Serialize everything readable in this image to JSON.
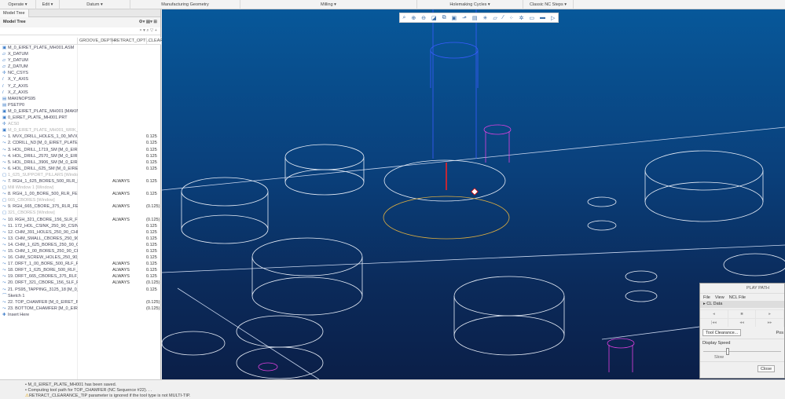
{
  "menubar": [
    "Operate ▾",
    "Edit ▾",
    "Datum ▾",
    "Manufacturing Geometry",
    "Milling ▾",
    "Holemaking Cycles ▾",
    "Classic NC Steps ▾"
  ],
  "tree": {
    "tab": "Model Tree",
    "title": "Model Tree",
    "columns": [
      "GROOVE_DEPTH",
      "RETRACT_OPTI...",
      "CLEAR"
    ],
    "rows": [
      {
        "n": "M_0_EIRET_PLATE_MH001.ASM",
        "i": "▣"
      },
      {
        "n": "X_DATUM",
        "i": "▱"
      },
      {
        "n": "Y_DATUM",
        "i": "▱"
      },
      {
        "n": "Z_DATUM",
        "i": "▱"
      },
      {
        "n": "NC_CSYS",
        "i": "✢"
      },
      {
        "n": "X_Y_AXIS",
        "i": "/"
      },
      {
        "n": "Y_Z_AXIS",
        "i": "/"
      },
      {
        "n": "X_Z_AXIS",
        "i": "/"
      },
      {
        "n": "MAKINOPS95",
        "i": "▤"
      },
      {
        "n": "PSETP0",
        "i": "▤"
      },
      {
        "n": "M_0_EIRET_PLATE_MH001 [MAKINOPS95",
        "i": "▣"
      },
      {
        "n": "0_EIRET_PLATE_MH001.PRT",
        "i": "▣"
      },
      {
        "n": "ACS0",
        "i": "✢",
        "g": 1
      },
      {
        "n": "M_0_EIRET_PLATE_MH001_WRK_01.PRT",
        "i": "▣",
        "g": 1
      },
      {
        "n": "1. MVX_DRILL_HOLES_1_00_MVX_DRILL [",
        "i": "⤳",
        "c": "0.125"
      },
      {
        "n": "2. CDRILL_N3 [M_0_EIRET_PLATE_MH001",
        "i": "⤳",
        "c": "0.125"
      },
      {
        "n": "3. HOL_DRILL_1719_SM [M_0_EIRET_PLA",
        "i": "⤳",
        "c": "0.125"
      },
      {
        "n": "4. HOL_DRILL_2570_SM [M_0_EIRET_PLA",
        "i": "⤳",
        "c": "0.125"
      },
      {
        "n": "5. HOL_DRILL_3906_SM [M_0_EIRET_PLA",
        "i": "⤳",
        "c": "0.125"
      },
      {
        "n": "6. HOL_DRILL_625_SM [M_0_EIRET_PLATE",
        "i": "⤳",
        "c": "0.125"
      },
      {
        "n": "1_625_SUPPORT_PILLARS [Window]",
        "i": "▢",
        "g": 1
      },
      {
        "n": "7. RGH_1_625_BORES_500_RLR_FEM [M_",
        "i": "⤳",
        "r": "ALWAYS",
        "c": "0.125"
      },
      {
        "n": "Mill Window 1 [Window]",
        "i": "▢",
        "g": 1
      },
      {
        "n": "8. RGH_1_00_BORE_500_RLR_FEM [M_0_",
        "i": "⤳",
        "r": "ALWAYS",
        "c": "0.125"
      },
      {
        "n": "665_CBORES [Window]",
        "i": "▢",
        "g": 1
      },
      {
        "n": "9. RGH_665_CBORE_375_RLR_FEM [M_0_",
        "i": "⤳",
        "r": "ALWAYS",
        "c": "(0.125)"
      },
      {
        "n": "321_CBORES [Window]",
        "i": "▢",
        "g": 1
      },
      {
        "n": "10. RGH_321_CBORE_156_SLR_FEM [M_0",
        "i": "⤳",
        "r": "ALWAYS",
        "c": "(0.125)"
      },
      {
        "n": "11. 172_HOL_CSINK_250_90_CSINK [M_0_",
        "i": "⤳",
        "c": "0.125"
      },
      {
        "n": "12. CHM_391_HOLES_250_90_CHM [M_0",
        "i": "⤳",
        "c": "0.125"
      },
      {
        "n": "13. CHM_SMALL_CBORES_250_90_CHM",
        "i": "⤳",
        "c": "0.125"
      },
      {
        "n": "14. CHM_1_625_BORES_250_90_CHM [M",
        "i": "⤳",
        "c": "0.125"
      },
      {
        "n": "15. CHM_1_00_BORES_250_90_CHM [M_",
        "i": "⤳",
        "c": "0.125"
      },
      {
        "n": "16. CHM_SCREW_HOLES_250_90_CHM [I",
        "i": "⤳",
        "c": "0.125"
      },
      {
        "n": "17. DRFT_1_00_BORE_500_RLF_FEM [M_0",
        "i": "⤳",
        "r": "ALWAYS",
        "c": "0.125"
      },
      {
        "n": "18. DRFT_1_625_BORE_500_RLF_FEM [M",
        "i": "⤳",
        "r": "ALWAYS",
        "c": "0.125"
      },
      {
        "n": "19. DRFT_665_CBORES_375_RLF_FEM [M",
        "i": "⤳",
        "r": "ALWAYS",
        "c": "0.125"
      },
      {
        "n": "20. DRFT_321_CBORE_156_SLF_FEM [M_0",
        "i": "⤳",
        "r": "ALWAYS",
        "c": "(0.125)"
      },
      {
        "n": "21. PS95_TAPPING_3125_18 [M_0_EIRET_",
        "i": "⤳",
        "c": "0.125"
      },
      {
        "n": "Sketch 1",
        "i": "⌒"
      },
      {
        "n": "22. TOP_CHAMFER [M_0_EIRET_PLATE_M",
        "i": "⤳",
        "c": "(0.125)"
      },
      {
        "n": "23. BOTTOM_CHAMFER [M_0_EIRET_PLA",
        "i": "⤳",
        "c": "(0.125)"
      },
      {
        "n": "Insert Here",
        "i": "✚"
      }
    ]
  },
  "status": [
    "M_0_EIRET_PLATE_MH001 has been saved.",
    "Computing tool path for TOP_CHAMFER (NC Sequence #22). . .",
    "RETRACT_CLEARANCE_TIP parameter is ignored if the tool type is not MULTI-TIP."
  ],
  "playpath": {
    "title": "PLAY PATH",
    "menu": [
      "File",
      "View",
      "NCL File"
    ],
    "cl_data": "CL Data",
    "tool_clearance": "Tool Clearance...",
    "pos": "Pos",
    "display_speed": "Display Speed",
    "slow": "Slow",
    "close": "Close"
  }
}
